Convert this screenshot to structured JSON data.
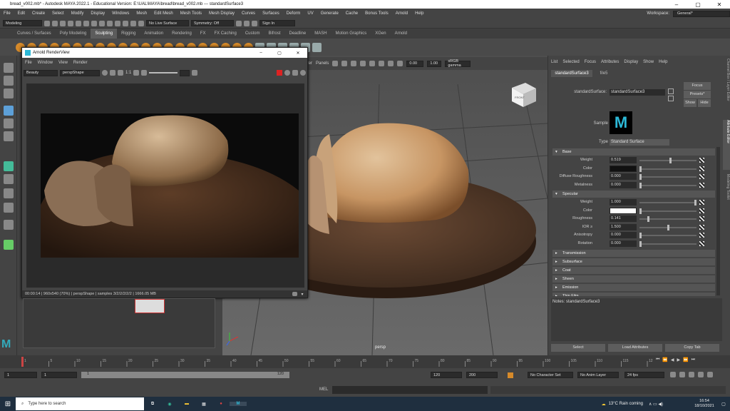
{
  "window": {
    "title": "bread_v002.mb* - Autodesk MAYA 2022.1 - Educational Version: E:\\UAL\\MAYA\\bread\\bread_v002.mb  ---  standardSurface3"
  },
  "menu": [
    "File",
    "Edit",
    "Create",
    "Select",
    "Modify",
    "Display",
    "Windows",
    "Mesh",
    "Edit Mesh",
    "Mesh Tools",
    "Mesh Display",
    "Curves",
    "Surfaces",
    "Deform",
    "UV",
    "Generate",
    "Cache",
    "Bonus Tools",
    "Arnold",
    "Help"
  ],
  "workspace": {
    "label": "Workspace:",
    "value": "General*"
  },
  "status": {
    "mode": "Modeling",
    "live": "No Live Surface",
    "symmetry": "Symmetry: Off",
    "signin": "Sign In"
  },
  "shelf_tabs": [
    "Curves / Surfaces",
    "Poly Modeling",
    "Sculpting",
    "Rigging",
    "Animation",
    "Rendering",
    "FX",
    "FX Caching",
    "Custom",
    "Bifrost",
    "Deadline",
    "MASH",
    "Motion Graphics",
    "XGen",
    "Arnold"
  ],
  "shelf_active": "Sculpting",
  "viewport": {
    "menu_fragment": "derer",
    "panels": "Panels",
    "exposure": "0.00",
    "gamma": "1.00",
    "colorspace": "sRGB gamma",
    "camera": "persp",
    "cube": "FRONT"
  },
  "renderview": {
    "title": "Arnold RenderView",
    "menu": [
      "File",
      "Window",
      "View",
      "Render"
    ],
    "aov": "Beauty",
    "camera": "perspShape",
    "ratio": "1:1",
    "status": "00:00:14 | 960x540 (70%) | perspShape | samples 3/2/2/2/2/2 | 1666.05 MB"
  },
  "attr": {
    "menu": [
      "List",
      "Selected",
      "Focus",
      "Attributes",
      "Display",
      "Show",
      "Help"
    ],
    "tabs": [
      "standardSurface3",
      "file5"
    ],
    "node_label": "standardSurface:",
    "node_value": "standardSurface3",
    "focus": "Focus",
    "presets": "Presets*",
    "show": "Show",
    "hide": "Hide",
    "sample": "Sample",
    "type_label": "Type",
    "type_value": "Standard Surface",
    "base": "Base",
    "specular": "Specular",
    "base_rows": [
      {
        "label": "Weight",
        "value": "0.519",
        "pos": 0.55
      },
      {
        "label": "Color",
        "value": "",
        "pos": -1
      },
      {
        "label": "Diffuse Roughness",
        "value": "0.000",
        "pos": 0
      },
      {
        "label": "Metalness",
        "value": "0.000",
        "pos": 0
      }
    ],
    "spec_rows": [
      {
        "label": "Weight",
        "value": "1.000",
        "pos": 1
      },
      {
        "label": "Color",
        "value": "",
        "pos": -1
      },
      {
        "label": "Roughness",
        "value": "0.141",
        "pos": 0.14
      },
      {
        "label": "IOR ≥",
        "value": "1.500",
        "pos": 0.5
      },
      {
        "label": "Anisotropy",
        "value": "0.000",
        "pos": 0
      },
      {
        "label": "Rotation",
        "value": "0.000",
        "pos": 0
      }
    ],
    "collapsed": [
      "Transmission",
      "Subsurface",
      "Coat",
      "Sheen",
      "Emission",
      "Thin Film"
    ],
    "notes": "Notes:  standardSurface3",
    "btn_select": "Select",
    "btn_load": "Load Attributes",
    "btn_copy": "Copy Tab",
    "side_tabs": [
      "Channel Box / Layer Editor",
      "Attribute Editor",
      "Modeling Toolkit"
    ]
  },
  "timeline": {
    "ticks": [
      "1",
      "5",
      "10",
      "15",
      "20",
      "25",
      "30",
      "35",
      "40",
      "45",
      "50",
      "55",
      "60",
      "65",
      "70",
      "75",
      "80",
      "85",
      "90",
      "95",
      "100",
      "105",
      "110",
      "115",
      "12"
    ],
    "current": "1"
  },
  "range": {
    "start": "1",
    "start2": "1",
    "inner_start": "1",
    "inner_end": "120",
    "end1": "120",
    "end2": "200",
    "character": "No Character Set",
    "anim": "No Anim Layer",
    "fps": "24 fps"
  },
  "mel": {
    "label": "MEL"
  },
  "taskbar": {
    "search": "Type here to search",
    "weather": "13°C  Rain coming",
    "time": "16:54",
    "date": "18/10/2021"
  }
}
